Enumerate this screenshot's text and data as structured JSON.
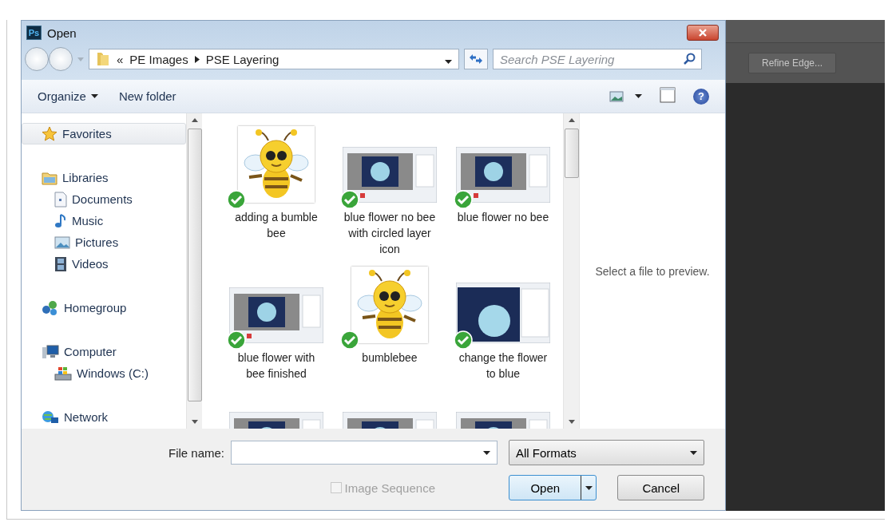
{
  "window": {
    "app_icon_text": "Ps",
    "title": "Open"
  },
  "address_bar": {
    "overflow_marker": "«",
    "path": [
      {
        "label": "PE Images"
      },
      {
        "label": "PSE Layering"
      }
    ]
  },
  "search": {
    "placeholder": "Search PSE Layering"
  },
  "toolbar": {
    "items": [
      {
        "label": "Organize",
        "kind": "menu"
      },
      {
        "label": "New folder",
        "kind": "button"
      }
    ],
    "help": "?"
  },
  "sidebar": {
    "groups": [
      {
        "label": "Favorites",
        "selected": true
      },
      {
        "label": "Libraries",
        "selected": false,
        "children": [
          {
            "label": "Documents",
            "selected": false
          },
          {
            "label": "Music",
            "selected": false
          },
          {
            "label": "Pictures",
            "selected": false
          },
          {
            "label": "Videos",
            "selected": false
          }
        ]
      },
      {
        "label": "Homegroup",
        "selected": false
      },
      {
        "label": "Computer",
        "selected": false,
        "children": [
          {
            "label": "Windows (C:)",
            "selected": false
          }
        ]
      },
      {
        "label": "Network",
        "selected": false
      }
    ]
  },
  "files": [
    {
      "name": "adding a bumble bee",
      "kind": "bee",
      "synced": true
    },
    {
      "name": "blue flower no bee with circled layer icon",
      "kind": "screenshot",
      "synced": true
    },
    {
      "name": "blue flower no bee",
      "kind": "screenshot",
      "synced": true
    },
    {
      "name": "blue flower with bee finished",
      "kind": "screenshot",
      "synced": true
    },
    {
      "name": "bumblebee",
      "kind": "bee",
      "synced": true
    },
    {
      "name": "change the flower to blue",
      "kind": "photo",
      "synced": true
    },
    {
      "kind": "screenshot"
    },
    {
      "kind": "screenshot"
    },
    {
      "kind": "screenshot"
    }
  ],
  "preview": {
    "message": "Select a file to preview."
  },
  "file_name": {
    "label": "File name:"
  },
  "format": {
    "value": "All Formats"
  },
  "image_sequence": {
    "label": "Image Sequence",
    "checked": false,
    "disabled": true
  },
  "buttons": [
    {
      "label": "Open",
      "kind": "split"
    },
    {
      "label": "Cancel",
      "kind": "plain"
    }
  ],
  "background_app": {
    "button": "Refine Edge..."
  }
}
